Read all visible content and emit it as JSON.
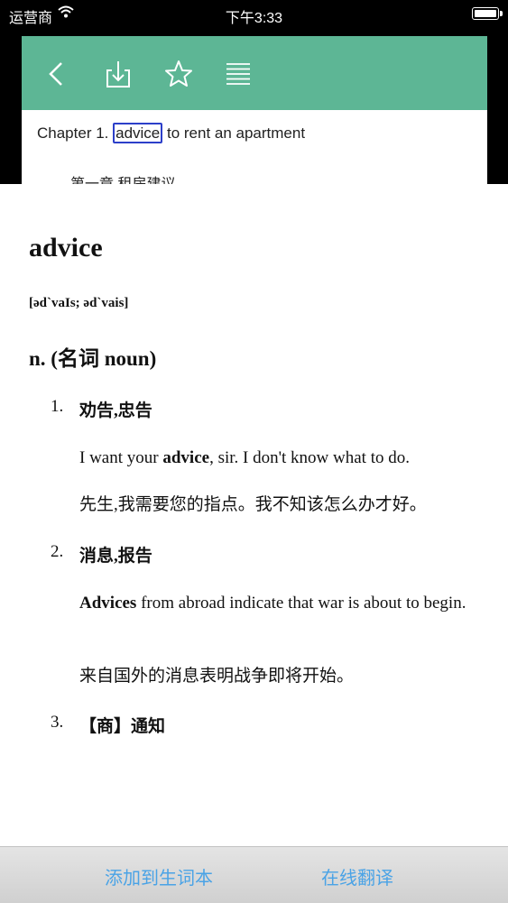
{
  "status_bar": {
    "carrier": "运营商",
    "time": "下午3:33"
  },
  "reader": {
    "toolbar": {
      "icons": [
        "back-icon",
        "download-icon",
        "star-icon",
        "menu-list-icon"
      ],
      "color": "#5db695"
    },
    "chapter_prefix": "Chapter 1. ",
    "selected_word": "advice",
    "chapter_suffix": " to rent an apartment",
    "chapter_subtitle": "第一章 租房建议"
  },
  "dictionary": {
    "headword": "advice",
    "phonetic": "[əd`vaIs; əd`vais]",
    "pos": "n. (名词 noun)",
    "senses": [
      {
        "num": "1.",
        "title": "劝告,忠告",
        "example_pre": "I want your ",
        "example_bold": "advice",
        "example_post": ", sir. I don't know what to do.",
        "translation": "先生,我需要您的指点。我不知该怎么办才好。"
      },
      {
        "num": "2.",
        "title": "消息,报告",
        "example_pre": "",
        "example_bold": "Advices",
        "example_post": " from abroad indicate that war is about to begin.",
        "translation": "来自国外的消息表明战争即将开始。"
      },
      {
        "num": "3.",
        "title": "【商】通知"
      }
    ]
  },
  "actions": {
    "add_to_wordbook": "添加到生词本",
    "online_translate": "在线翻译",
    "color": "#4aa3e6"
  }
}
